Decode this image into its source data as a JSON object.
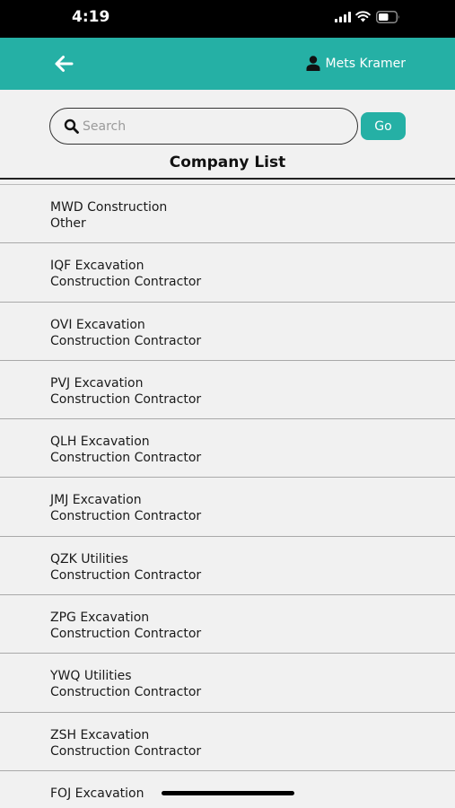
{
  "status_bar": {
    "time": "4:19"
  },
  "header": {
    "user_name": "Mets Kramer",
    "accent": "#25b0a5"
  },
  "search": {
    "placeholder": "Search",
    "value": "",
    "go_label": "Go"
  },
  "page_title": "Company List",
  "companies": [
    {
      "name": "MWD Construction",
      "type": "Other"
    },
    {
      "name": "IQF Excavation",
      "type": "Construction Contractor"
    },
    {
      "name": "OVI Excavation",
      "type": "Construction Contractor"
    },
    {
      "name": "PVJ Excavation",
      "type": "Construction Contractor"
    },
    {
      "name": "QLH Excavation",
      "type": "Construction Contractor"
    },
    {
      "name": "JMJ Excavation",
      "type": "Construction Contractor"
    },
    {
      "name": "QZK Utilities",
      "type": "Construction Contractor"
    },
    {
      "name": "ZPG Excavation",
      "type": "Construction Contractor"
    },
    {
      "name": "YWQ Utilities",
      "type": "Construction Contractor"
    },
    {
      "name": "ZSH Excavation",
      "type": "Construction Contractor"
    },
    {
      "name": "FOJ Excavation",
      "type": ""
    }
  ]
}
